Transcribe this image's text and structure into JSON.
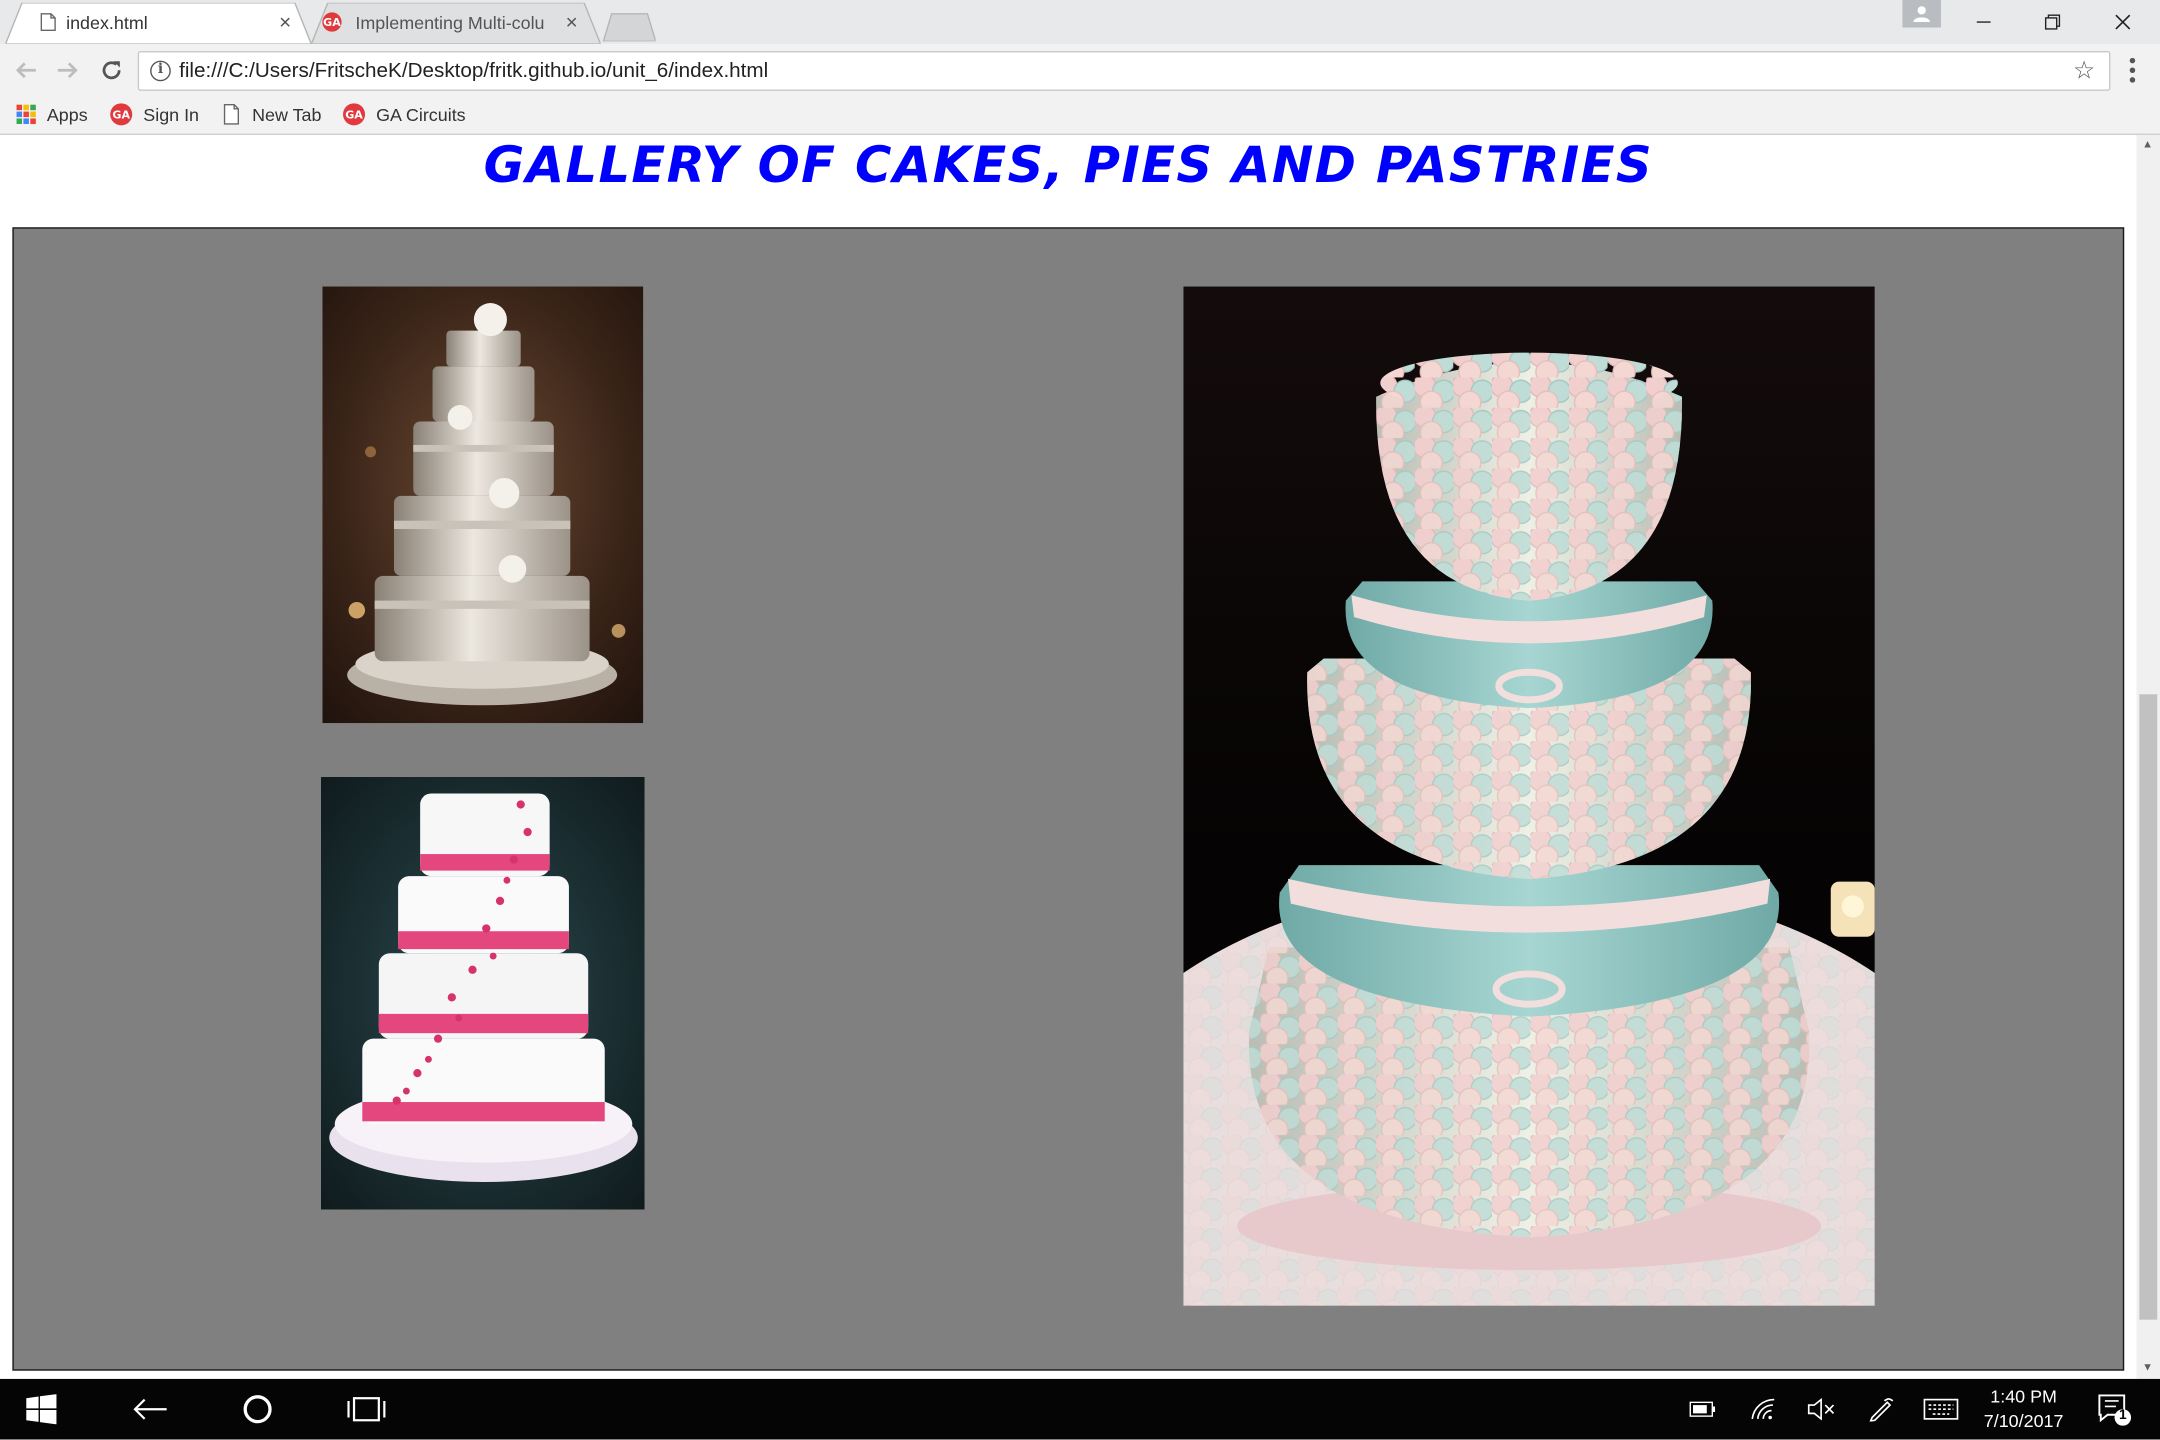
{
  "browser": {
    "tabs": [
      {
        "title": "index.html",
        "active": true,
        "icon": "page-icon"
      },
      {
        "title": "Implementing Multi-colu",
        "active": false,
        "icon": "ga-icon"
      }
    ],
    "address_url": "file:///C:/Users/FritscheK/Desktop/fritk.github.io/unit_6/index.html",
    "bookmarks": [
      {
        "label": "Apps",
        "icon": "apps-grid-icon"
      },
      {
        "label": "Sign In",
        "icon": "ga-icon"
      },
      {
        "label": "New Tab",
        "icon": "page-icon"
      },
      {
        "label": "GA Circuits",
        "icon": "ga-icon"
      }
    ],
    "ga_badge_text": "GA"
  },
  "page": {
    "title": "GALLERY OF CAKES, PIES AND PASTRIES",
    "title_color": "#0000ff",
    "gallery_background": "#808080",
    "images": [
      {
        "name": "silver-tiered-wedding-cake"
      },
      {
        "name": "pink-ribbon-wedding-cake"
      },
      {
        "name": "pastel-petal-wedding-cake"
      }
    ]
  },
  "taskbar": {
    "time": "1:40 PM",
    "date": "7/10/2017",
    "notification_count": "1"
  }
}
